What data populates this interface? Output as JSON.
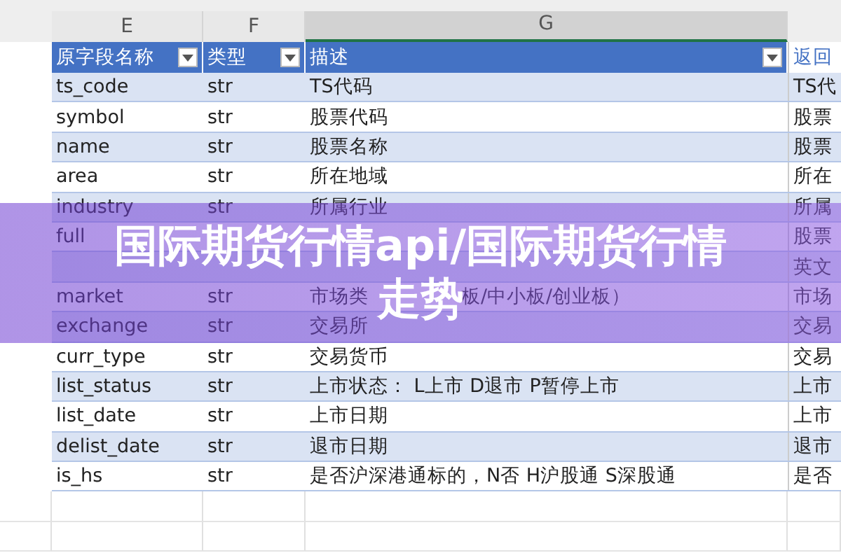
{
  "column_letters": [
    {
      "label": "E",
      "selected": false
    },
    {
      "label": "F",
      "selected": false
    },
    {
      "label": "G",
      "selected": true
    }
  ],
  "table": {
    "columns": [
      {
        "label": "原字段名称",
        "filter": true
      },
      {
        "label": "类型",
        "filter": true
      },
      {
        "label": "描述",
        "filter": true
      },
      {
        "label": "返回",
        "filter": false
      }
    ],
    "rows": [
      {
        "field": "ts_code",
        "type": "str",
        "description": [
          "TS代码"
        ],
        "returns": "TS代"
      },
      {
        "field": "symbol",
        "type": "str",
        "description": [
          "股票代码"
        ],
        "returns": "股票"
      },
      {
        "field": "name",
        "type": "str",
        "description": [
          "股票名称"
        ],
        "returns": "股票"
      },
      {
        "field": "area",
        "type": "str",
        "description": [
          "所在地域"
        ],
        "returns": "所在"
      },
      {
        "field": "industry",
        "type": "str",
        "description": [
          "所属行业"
        ],
        "returns": "所属"
      },
      {
        "field": "full",
        "returns": "股票"
      },
      {
        "returns": "英文"
      },
      {
        "field": "market",
        "type": "str",
        "description": [
          "市场类",
          "板/中小板/创业板）"
        ],
        "returns": "市场"
      },
      {
        "field": "exchange",
        "type": "str",
        "description": [
          "交易所"
        ],
        "returns": "交易"
      },
      {
        "field": "curr_type",
        "type": "str",
        "description": [
          "交易货币"
        ],
        "returns": "交易"
      },
      {
        "field": "list_status",
        "type": "str",
        "description": [
          "上市状态：  L上市 D退市 P暂停上市"
        ],
        "returns": "上市"
      },
      {
        "field": "list_date",
        "type": "str",
        "description": [
          "上市日期"
        ],
        "returns": "上市"
      },
      {
        "field": "delist_date",
        "type": "str",
        "description": [
          "退市日期"
        ],
        "returns": "退市"
      },
      {
        "field": "is_hs",
        "type": "str",
        "description": [
          "是否沪深港通标的，N否 H沪股通 S深股通"
        ],
        "returns": "是否"
      }
    ]
  },
  "banner": {
    "title_lines": [
      "国际期货行情api/国际期货行情",
      "走势"
    ]
  }
}
